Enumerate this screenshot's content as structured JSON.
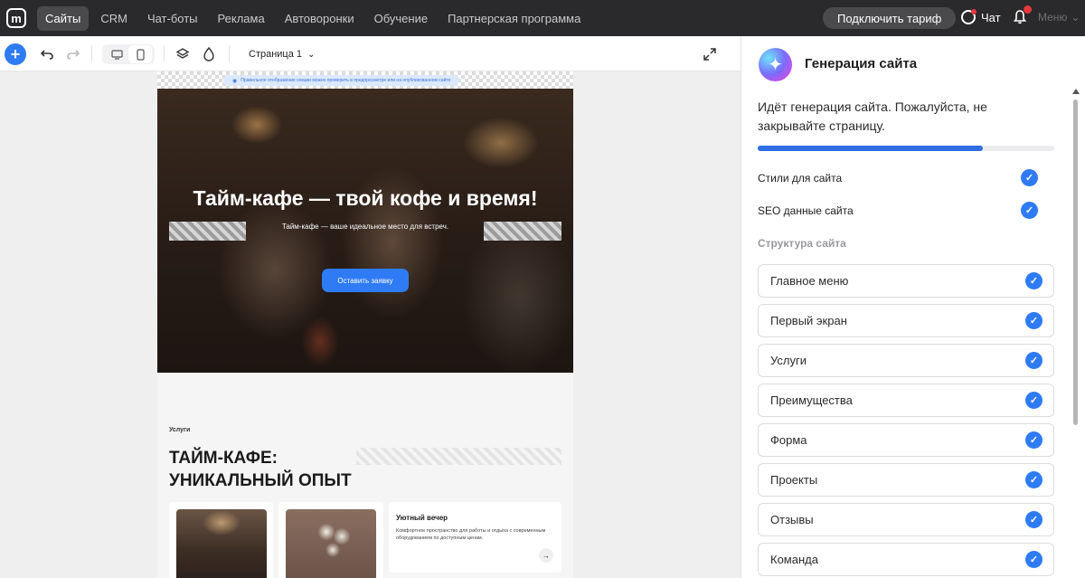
{
  "topnav": {
    "logo": "m",
    "items": [
      "Сайты",
      "CRM",
      "Чат-боты",
      "Реклама",
      "Автоворонки",
      "Обучение",
      "Партнерская программа"
    ],
    "connect_label": "Подключить тариф",
    "chat_label": "Чат",
    "menu_label": "Меню"
  },
  "toolbar": {
    "page_label": "Страница 1"
  },
  "canvas": {
    "preview_note": "Правильное отображение секции можно проверить в предпросмотре или на опубликованном сайте",
    "hero_title": "Тайм-кафе — твой кофе и время!",
    "hero_subtitle": "Тайм-кафе — ваше идеальное место для встреч.",
    "cta_label": "Оставить заявку",
    "services_label": "Услуги",
    "services_title_line1": "ТАЙМ-КАФЕ:",
    "services_title_line2": "УНИКАЛЬНЫЙ ОПЫТ",
    "card3_title": "Уютный вечер",
    "card3_text": "Комфортное пространство для работы и отдыха с современным оборудованием по доступным ценам."
  },
  "panel": {
    "title": "Генерация сайта",
    "message": "Идёт генерация сайта. Пожалуйста, не закрывайте страницу.",
    "progress": 0.76,
    "checks": [
      "Стили для сайта",
      "SEO данные сайта"
    ],
    "structure_label": "Структура сайта",
    "structure_items": [
      "Главное меню",
      "Первый экран",
      "Услуги",
      "Преимущества",
      "Форма",
      "Проекты",
      "Отзывы",
      "Команда"
    ]
  },
  "colors": {
    "accent": "#2f7bf5",
    "nav_bg": "#2a2a2c"
  }
}
